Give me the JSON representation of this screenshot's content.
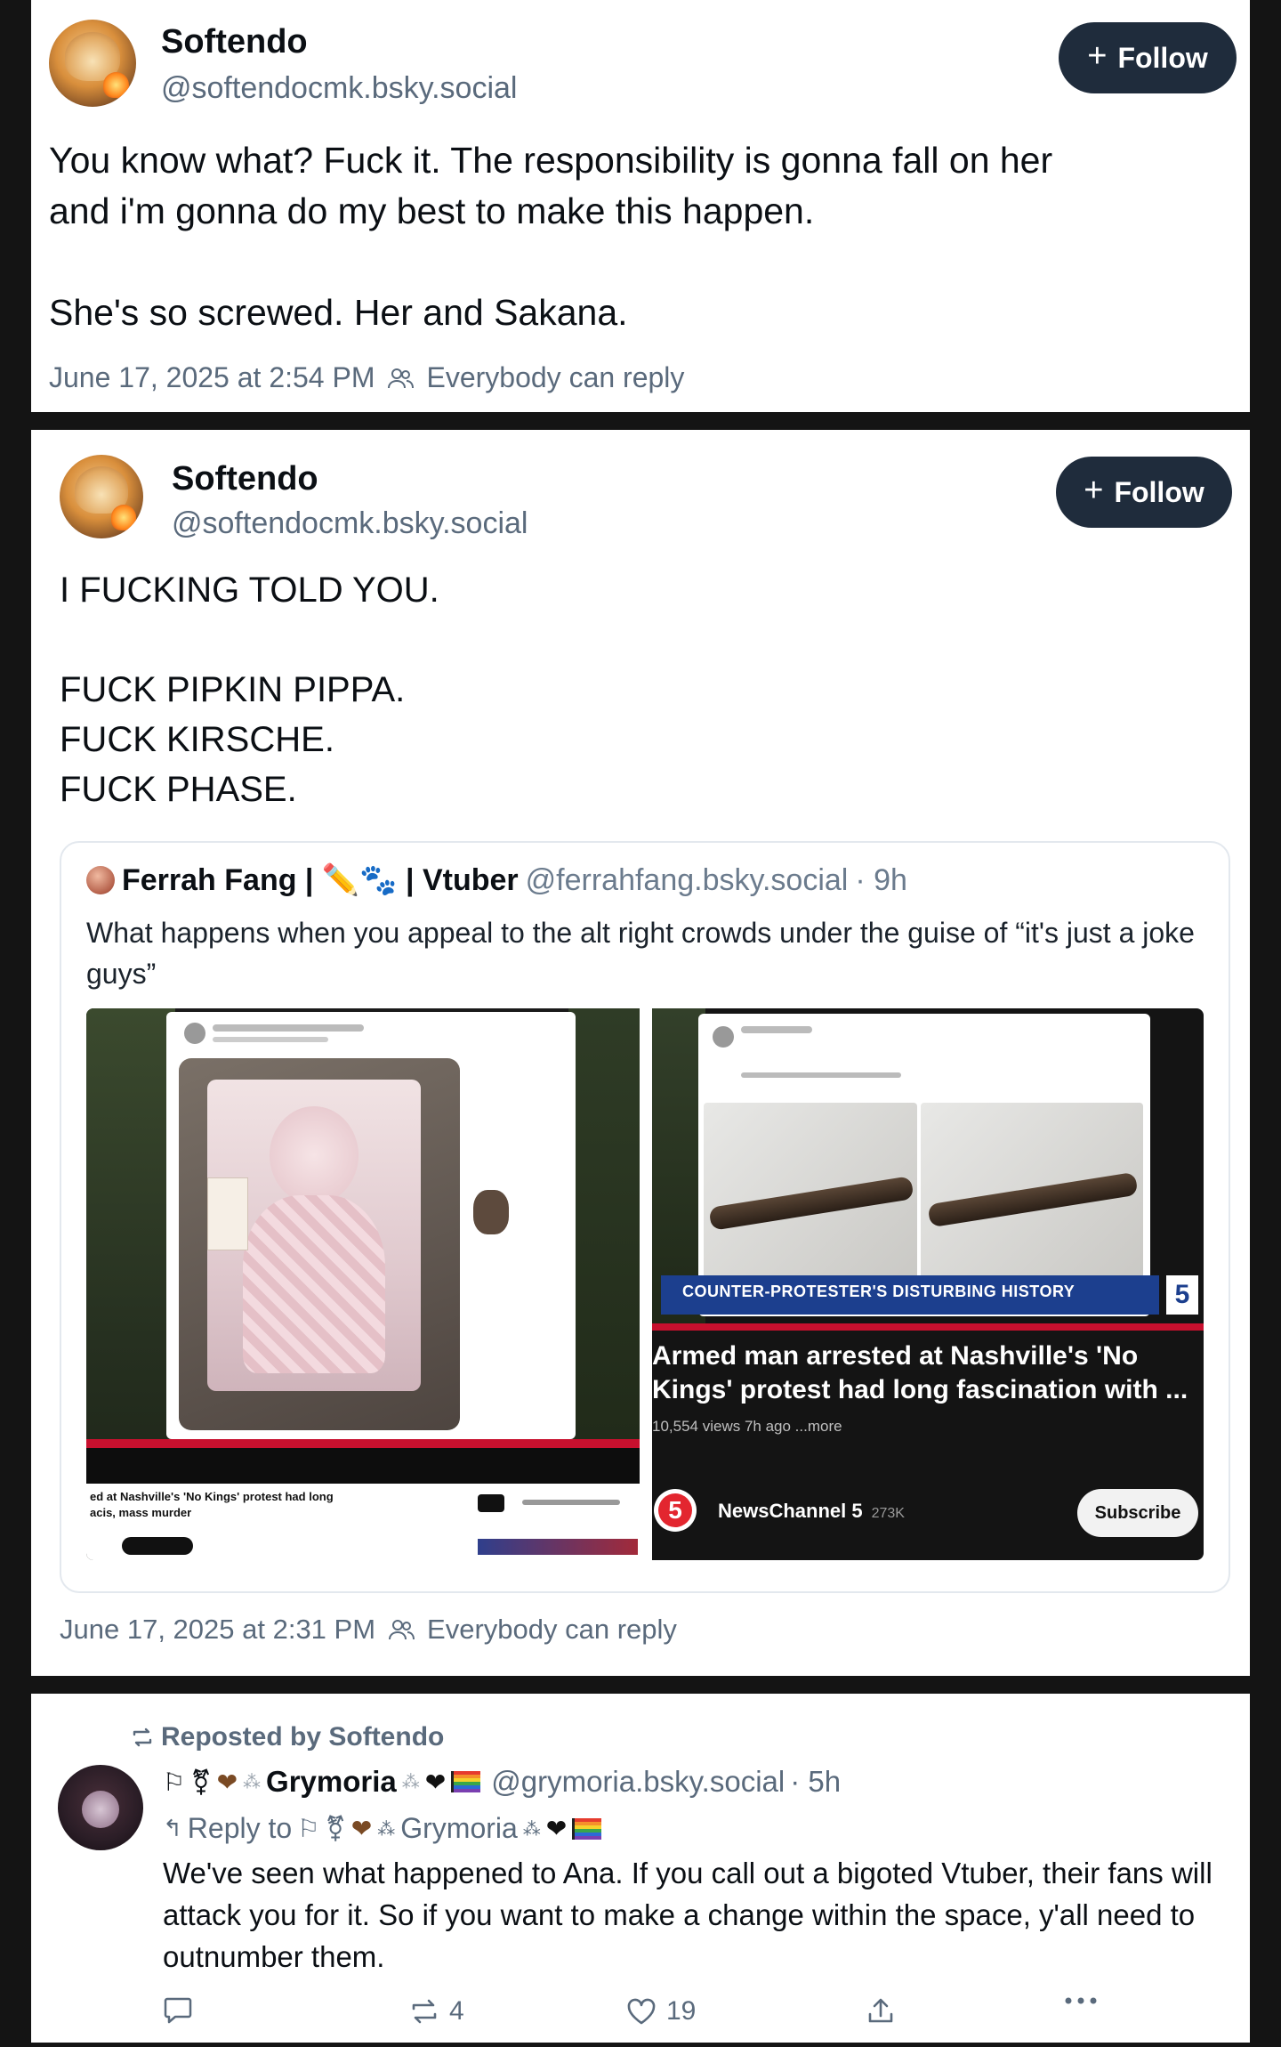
{
  "card1": {
    "author_name": "Softendo",
    "author_handle": "@softendocmk.bsky.social",
    "follow_label": "Follow",
    "text": "You know what? Fuck it. The responsibility is gonna fall on her\nand i'm gonna do my best to make this happen.\n\nShe's so screwed. Her and Sakana.",
    "timestamp": "June 17, 2025 at 2:54 PM",
    "reply_setting": "Everybody can reply"
  },
  "card2": {
    "author_name": "Softendo",
    "author_handle": "@softendocmk.bsky.social",
    "follow_label": "Follow",
    "text": "I FUCKING TOLD YOU.\n\nFUCK PIPKIN PIPPA.\nFUCK KIRSCHE.\nFUCK PHASE.",
    "quote": {
      "author_name": "Ferrah Fang | ✏️🐾 | Vtuber",
      "author_handle": "@ferrahfang.bsky.social",
      "age": "· 9h",
      "text": "What happens when you appeal to the alt right crowds under the guise of “it's just a joke guys”",
      "right_image": {
        "banner": "COUNTER-PROTESTER'S DISTURBING HISTORY",
        "video_title": "Armed man arrested at Nashville's 'No Kings' protest had long fascination with ...",
        "video_meta": "10,554 views  7h ago  ...more",
        "channel_name": "NewsChannel 5",
        "channel_subs": "273K",
        "subscribe_label": "Subscribe",
        "channel_logo": "5"
      },
      "left_image": {
        "caption": "ed at Nashville's 'No Kings' protest had long\nacis, mass murder"
      }
    },
    "timestamp": "June 17, 2025 at 2:31 PM",
    "reply_setting": "Everybody can reply"
  },
  "card3": {
    "repost_label": "Reposted by Softendo",
    "author_name": "Grymoria",
    "author_handle": "@grymoria.bsky.social",
    "age": "· 5h",
    "reply_to_label": "Reply to",
    "reply_to_name": "Grymoria",
    "text": "We've seen what happened to Ana. If you call out a bigoted Vtuber, their fans will attack you for it. So if you want to make a change within the space, y'all need to outnumber them.",
    "repost_count": "4",
    "like_count": "19"
  }
}
